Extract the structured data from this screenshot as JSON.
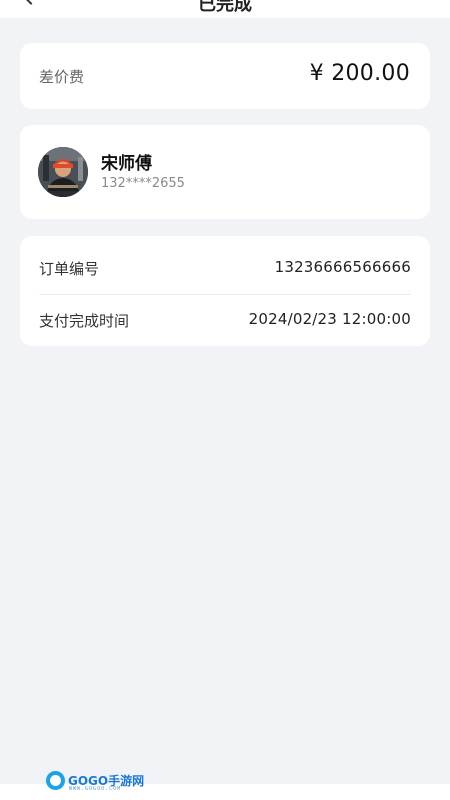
{
  "nav": {
    "title": "已完成"
  },
  "fee": {
    "label": "差价费",
    "value": "¥ 200.00"
  },
  "driver": {
    "name": "宋师傅",
    "phone": "132****2655"
  },
  "order": {
    "rows": [
      {
        "label": "订单编号",
        "value": "13236666566666"
      },
      {
        "label": "支付完成时间",
        "value": "2024/02/23  12:00:00"
      }
    ]
  },
  "watermark": {
    "brand": "GOGO手游网",
    "url": "WWW.GOGO0.COM"
  },
  "colors": {
    "background": "#f2f3f7",
    "card": "#ffffff",
    "watermark": "#1a78d6"
  }
}
